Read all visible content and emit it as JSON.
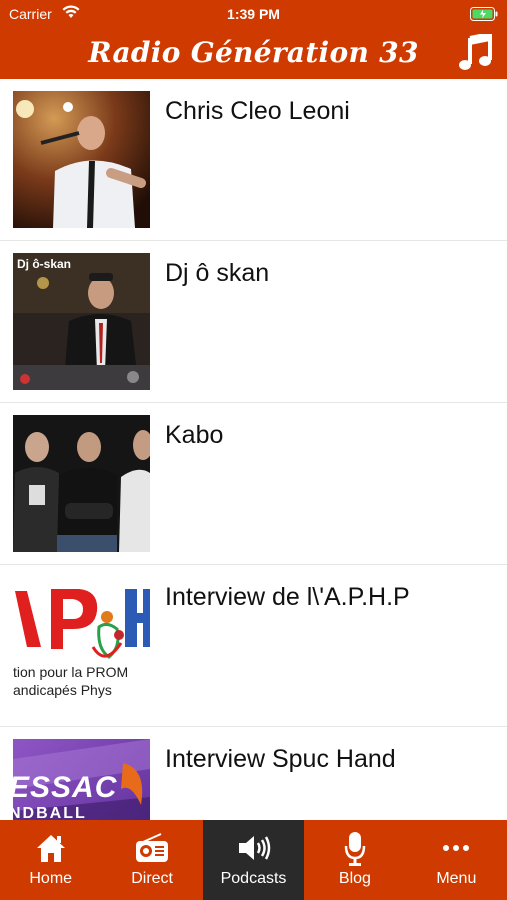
{
  "status_bar": {
    "carrier": "Carrier",
    "time": "1:39 PM"
  },
  "header": {
    "title": "Radio Génération 33",
    "music_icon": "music-note-icon"
  },
  "podcasts": [
    {
      "title": "Chris Cleo Leoni"
    },
    {
      "title": "Dj ô skan",
      "thumb_caption": "Dj ô-skan"
    },
    {
      "title": "Kabo"
    },
    {
      "title": "Interview de l\\'A.P.H.P",
      "thumb_text_1": "tion pour la PROM",
      "thumb_text_2": "andicapés Phys"
    },
    {
      "title": "Interview Spuc Hand",
      "thumb_text_1": "ESSAC",
      "thumb_text_2": "NDBALL"
    }
  ],
  "tabs": [
    {
      "label": "Home",
      "icon": "home-icon"
    },
    {
      "label": "Direct",
      "icon": "radio-icon"
    },
    {
      "label": "Podcasts",
      "icon": "speaker-icon",
      "active": true
    },
    {
      "label": "Blog",
      "icon": "microphone-icon"
    },
    {
      "label": "Menu",
      "icon": "more-dots-icon"
    }
  ],
  "colors": {
    "brand": "#cf3a00",
    "active_tab": "#2a2a2a"
  }
}
